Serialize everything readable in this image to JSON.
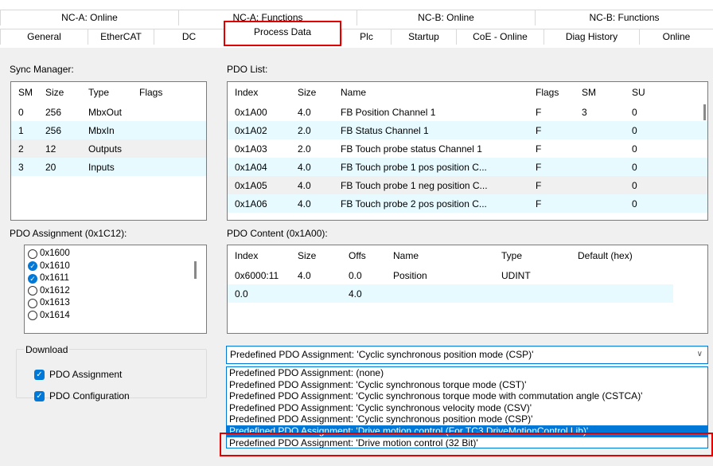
{
  "tabs_row1": [
    {
      "label": "NC-A: Online"
    },
    {
      "label": "NC-A: Functions"
    },
    {
      "label": "NC-B: Online"
    },
    {
      "label": "NC-B: Functions"
    }
  ],
  "tabs_row2": [
    {
      "label": "General"
    },
    {
      "label": "EtherCAT"
    },
    {
      "label": "DC"
    },
    {
      "label": "Process Data"
    },
    {
      "label": "Plc"
    },
    {
      "label": "Startup"
    },
    {
      "label": "CoE - Online"
    },
    {
      "label": "Diag History"
    },
    {
      "label": "Online"
    }
  ],
  "sync_manager": {
    "label": "Sync Manager:",
    "headers": [
      "SM",
      "Size",
      "Type",
      "Flags"
    ],
    "rows": [
      [
        "0",
        "256",
        "MbxOut",
        ""
      ],
      [
        "1",
        "256",
        "MbxIn",
        ""
      ],
      [
        "2",
        "12",
        "Outputs",
        ""
      ],
      [
        "3",
        "20",
        "Inputs",
        ""
      ]
    ]
  },
  "pdo_list": {
    "label": "PDO List:",
    "headers": [
      "Index",
      "Size",
      "Name",
      "Flags",
      "SM",
      "SU"
    ],
    "rows": [
      [
        "0x1A00",
        "4.0",
        "FB Position Channel 1",
        "F",
        "3",
        "0"
      ],
      [
        "0x1A02",
        "2.0",
        "FB Status Channel 1",
        "F",
        "",
        "0"
      ],
      [
        "0x1A03",
        "2.0",
        "FB Touch probe status Channel 1",
        "F",
        "",
        "0"
      ],
      [
        "0x1A04",
        "4.0",
        "FB Touch probe 1 pos position C...",
        "F",
        "",
        "0"
      ],
      [
        "0x1A05",
        "4.0",
        "FB Touch probe 1 neg position C...",
        "F",
        "",
        "0"
      ],
      [
        "0x1A06",
        "4.0",
        "FB Touch probe 2 pos position C...",
        "F",
        "",
        "0"
      ]
    ]
  },
  "pdo_assignment": {
    "label": "PDO Assignment (0x1C12):",
    "items": [
      {
        "label": "0x1600",
        "checked": false
      },
      {
        "label": "0x1610",
        "checked": true
      },
      {
        "label": "0x1611",
        "checked": true
      },
      {
        "label": "0x1612",
        "checked": false
      },
      {
        "label": "0x1613",
        "checked": false
      },
      {
        "label": "0x1614",
        "checked": false
      }
    ]
  },
  "pdo_content": {
    "label": "PDO Content (0x1A00):",
    "headers": [
      "Index",
      "Size",
      "Offs",
      "Name",
      "Type",
      "Default (hex)"
    ],
    "rows": [
      [
        "0x6000:11",
        "4.0",
        "0.0",
        "Position",
        "UDINT",
        ""
      ],
      [
        "0.0",
        "",
        "4.0",
        "",
        "",
        ""
      ]
    ]
  },
  "download": {
    "label": "Download",
    "items": [
      {
        "label": "PDO Assignment",
        "checked": true
      },
      {
        "label": "PDO Configuration",
        "checked": true
      }
    ]
  },
  "predefined": {
    "selected": "Predefined PDO Assignment: 'Cyclic synchronous position mode (CSP)'",
    "options": [
      "Predefined PDO Assignment: (none)",
      "Predefined PDO Assignment: 'Cyclic synchronous torque mode (CST)'",
      "Predefined PDO Assignment: 'Cyclic synchronous torque mode with commutation angle (CSTCA)'",
      "Predefined PDO Assignment: 'Cyclic synchronous velocity mode (CSV)'",
      "Predefined PDO Assignment: 'Cyclic synchronous position mode (CSP)'",
      "Predefined PDO Assignment: 'Drive motion control (For TC3 DriveMotionControl Lib)'",
      "Predefined PDO Assignment: 'Drive motion control (32 Bit)'"
    ],
    "highlighted_index": 5
  },
  "colors": {
    "accent": "#0078d7",
    "highlight_box": "#e00000",
    "selected_row": "#e6faff"
  },
  "icons": {
    "dropdown": "chevron-down-icon",
    "check": "check-icon"
  }
}
